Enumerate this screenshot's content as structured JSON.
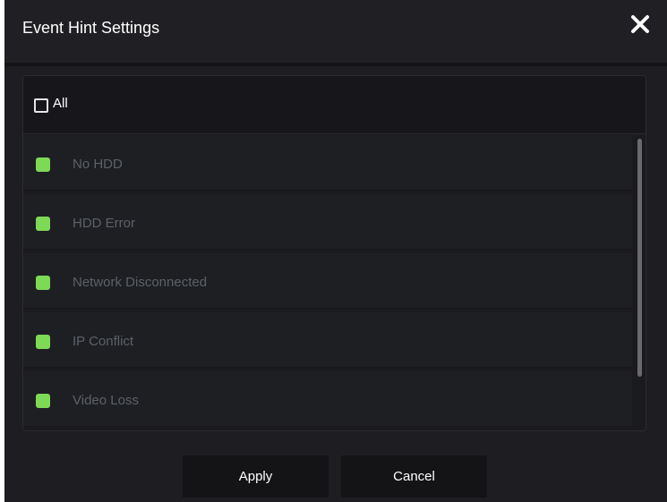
{
  "dialog": {
    "title": "Event Hint Settings",
    "close_icon": "close-icon"
  },
  "all": {
    "label": "All",
    "checked": false
  },
  "events": [
    {
      "label": "No HDD",
      "checked": true
    },
    {
      "label": "HDD Error",
      "checked": true
    },
    {
      "label": "Network Disconnected",
      "checked": true
    },
    {
      "label": "IP Conflict",
      "checked": true
    },
    {
      "label": "Video Loss",
      "checked": true
    }
  ],
  "buttons": {
    "apply": "Apply",
    "cancel": "Cancel"
  },
  "colors": {
    "checked": "#7ed957",
    "background": "#1e1e22",
    "disabled_text": "#5c6168"
  }
}
